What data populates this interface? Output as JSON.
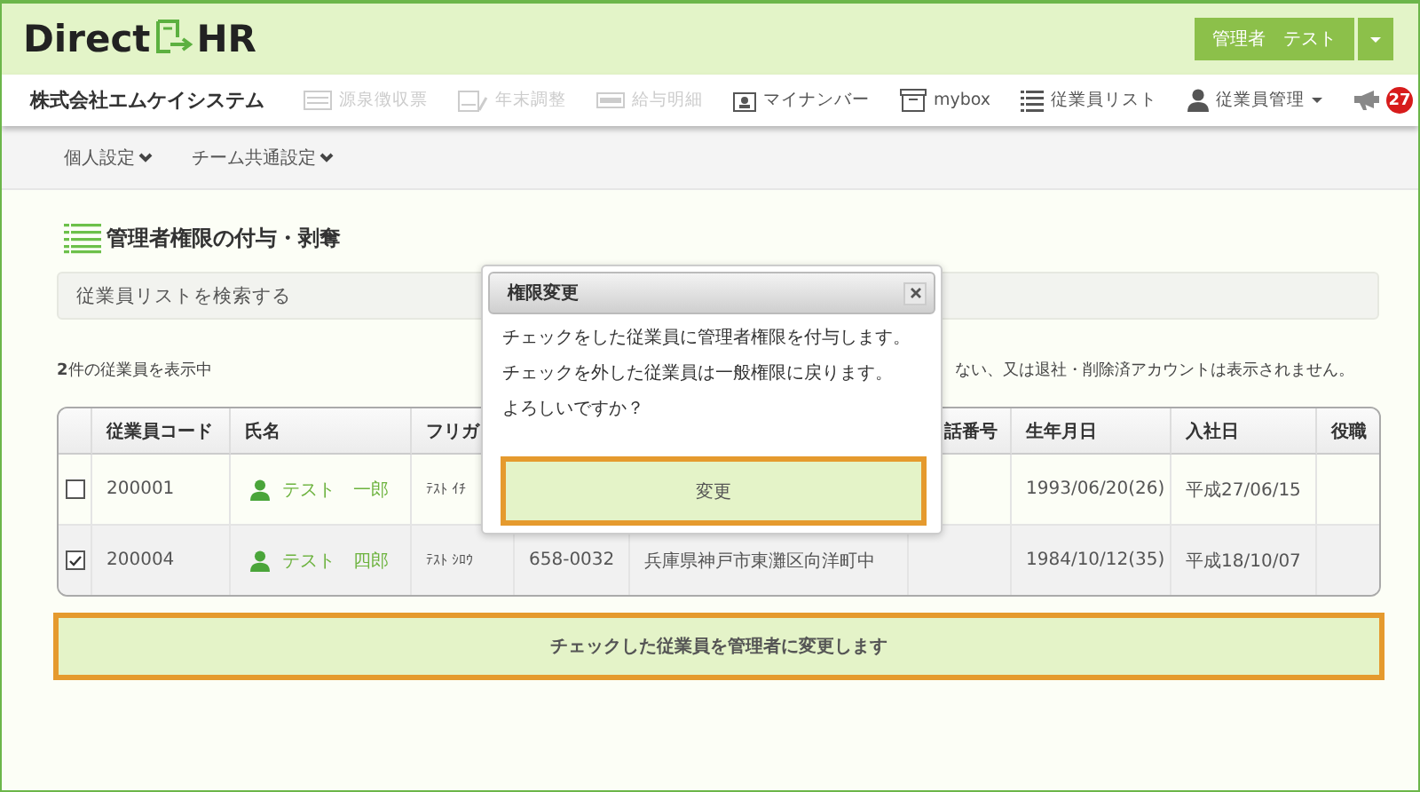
{
  "logo": {
    "left": "Direct",
    "right": "HR"
  },
  "user_menu": {
    "label": "管理者　テスト"
  },
  "company": "株式会社エムケイシステム",
  "nav": [
    {
      "label": "源泉徴収票",
      "kind": "card",
      "disabled": true
    },
    {
      "label": "年末調整",
      "kind": "form",
      "disabled": true
    },
    {
      "label": "給与明細",
      "kind": "slip",
      "disabled": true
    },
    {
      "label": "マイナンバー",
      "kind": "id",
      "disabled": false
    },
    {
      "label": "mybox",
      "kind": "box",
      "disabled": false
    },
    {
      "label": "従業員リスト",
      "kind": "list",
      "disabled": false
    },
    {
      "label": "従業員管理",
      "kind": "person",
      "disabled": false
    }
  ],
  "notifications": {
    "count": "27"
  },
  "subnav": [
    {
      "label": "個人設定"
    },
    {
      "label": "チーム共通設定"
    }
  ],
  "page_title": "管理者権限の付与・剥奪",
  "search": {
    "label": "従業員リストを検索する"
  },
  "info": {
    "count_text": "**2**件の従業員を表示中",
    "note": "ない、又は退社・削除済アカウントは表示されません。"
  },
  "table": {
    "headers": {
      "code": "従業員コード",
      "name": "氏名",
      "furigana": "フリガ",
      "phone": "話番号",
      "birth": "生年月日",
      "joined": "入社日",
      "role": "役職"
    },
    "rows": [
      {
        "checked": false,
        "code": "200001",
        "name": "テスト　一郎",
        "furigana": "ﾃｽﾄ ｲﾁ",
        "birth": "1993/06/20(26)",
        "joined": "平成27/06/15"
      },
      {
        "checked": true,
        "code": "200004",
        "name": "テスト　四郎",
        "furigana": "ﾃｽﾄ ｼﾛｳ",
        "postal": "658-0032",
        "address": "兵庫県神戸市東灘区向洋町中",
        "birth": "1984/10/12(35)",
        "joined": "平成18/10/07"
      }
    ]
  },
  "dialog": {
    "title": "権限変更",
    "lines": [
      "チェックをした従業員に管理者権限を付与します。",
      "チェックを外した従業員は一般権限に戻ります。",
      "よろしいですか？"
    ],
    "button": "変更"
  },
  "submit_button": "チェックした従業員を管理者に変更します"
}
